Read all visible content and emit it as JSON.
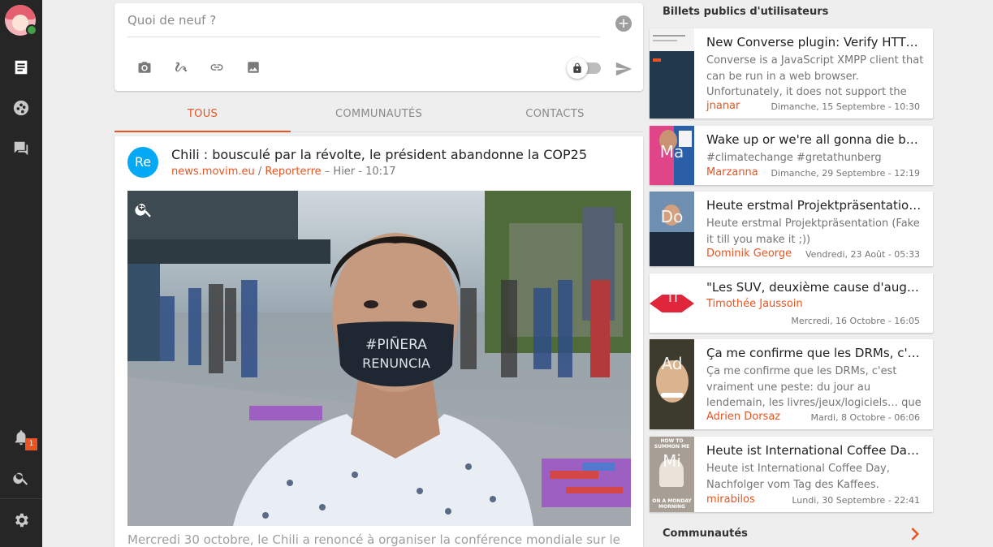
{
  "composer": {
    "placeholder": "Quoi de neuf ?"
  },
  "tabs": [
    {
      "label": "TOUS",
      "active": true
    },
    {
      "label": "COMMUNAUTÉS",
      "active": false
    },
    {
      "label": "CONTACTS",
      "active": false
    }
  ],
  "post": {
    "avatar_initials": "Re",
    "title": "Chili : bousculé par la révolte, le président abandonne la COP25",
    "source": "news.movim.eu",
    "separator": " / ",
    "community": "Reporterre",
    "time": " – Hier - 10:17",
    "mask_text_line1": "#PIÑERA",
    "mask_text_line2": "RENUNCIA",
    "excerpt": "Mercredi 30 octobre, le Chili a renoncé à organiser la conférence mondiale sur le"
  },
  "notifications": {
    "count": "1"
  },
  "public_posts": {
    "heading": "Billets publics d'utilisateurs",
    "items": [
      {
        "title": "New Converse plugin: Verify HTTP …",
        "body": "Converse is a JavaScript XMPP client that can be run in a web browser. Unfortunately, it does not support the",
        "author": "jnanar",
        "date": "Dimanche, 15 Septembre - 10:30",
        "initials": ""
      },
      {
        "title": "Wake up or we're all gonna die by …",
        "body": "#climatechange #gretathunberg",
        "author": "Marzanna",
        "date": "Dimanche, 29 Septembre - 12:19",
        "initials": "Ma"
      },
      {
        "title": "Heute erstmal Projektpräsentatio…",
        "body": "Heute erstmal Projektpräsentation (Fake it till you make it ;))",
        "author": "Dominik George",
        "date": "Vendredi, 23 Août - 05:33",
        "initials": "Do"
      },
      {
        "title": "\"Les SUV, deuxième cause d'augm…",
        "body": "",
        "author": "Timothée Jaussoin",
        "date": "Mercredi, 16 Octobre - 16:05",
        "initials": "Ti"
      },
      {
        "title": "Ça me confirme que les DRMs, c'e…",
        "body": "Ça me confirme que les DRMs, c'est vraiment une peste: du jour au lendemain, les livres/jeux/logiciels… que",
        "author": "Adrien Dorsaz",
        "date": "Mardi, 8 Octobre - 06:06",
        "initials": "Ad"
      },
      {
        "title": "Heute ist International Coffee Day…",
        "body": "Heute ist International Coffee Day, Nachfolger vom Tag des Kaffees.",
        "author": "mirabilos",
        "date": "Lundi, 30 Septembre - 22:41",
        "initials": "Mi",
        "thumb_caption_top": "HOW TO SUMMON ME",
        "thumb_caption_bottom": "ON A MONDAY MORNING"
      }
    ]
  },
  "communities": {
    "label": "Communautés"
  },
  "colors": {
    "accent": "#e95420",
    "rail": "#262626",
    "background": "#eeeeee",
    "avatar_blue": "#03a9f4",
    "presence_green": "#43a047"
  }
}
